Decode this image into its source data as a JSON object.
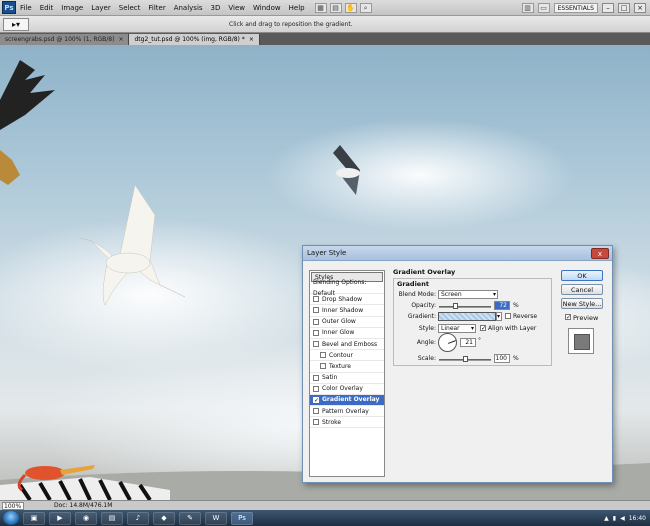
{
  "app": {
    "logo_text": "Ps",
    "menu": [
      "File",
      "Edit",
      "Image",
      "Layer",
      "Select",
      "Filter",
      "Analysis",
      "3D",
      "View",
      "Window",
      "Help"
    ],
    "workspace": "ESSENTIALS"
  },
  "options_bar": {
    "hint": "Click and drag to reposition the gradient."
  },
  "tabs": [
    {
      "label": "screengrabs.psd @ 100% (1, RGB/8)",
      "close": "×"
    },
    {
      "label": "dtg2_tut.psd @ 100% (img, RGB/8) *",
      "close": "×"
    }
  ],
  "status_bar": {
    "zoom": "100%",
    "doc": "Doc: 14.8M/476.1M"
  },
  "taskbar": {
    "clock": "16:40"
  },
  "dialog": {
    "title": "Layer Style",
    "close_label": "x",
    "styles": [
      {
        "label": "Styles",
        "type": "header"
      },
      {
        "label": "Blending Options: Default",
        "type": "plain"
      },
      {
        "label": "Drop Shadow",
        "checked": false
      },
      {
        "label": "Inner Shadow",
        "checked": false
      },
      {
        "label": "Outer Glow",
        "checked": false
      },
      {
        "label": "Inner Glow",
        "checked": false
      },
      {
        "label": "Bevel and Emboss",
        "checked": false
      },
      {
        "label": "Contour",
        "checked": false,
        "indent": true
      },
      {
        "label": "Texture",
        "checked": false,
        "indent": true
      },
      {
        "label": "Satin",
        "checked": false
      },
      {
        "label": "Color Overlay",
        "checked": false
      },
      {
        "label": "Gradient Overlay",
        "checked": true,
        "selected": true
      },
      {
        "label": "Pattern Overlay",
        "checked": false
      },
      {
        "label": "Stroke",
        "checked": false
      }
    ],
    "panel": {
      "title": "Gradient Overlay",
      "group": "Gradient",
      "blend_mode_label": "Blend Mode:",
      "blend_mode": "Screen",
      "opacity_label": "Opacity:",
      "opacity": "72",
      "opacity_fraction": 0.3,
      "percent": "%",
      "gradient_label": "Gradient:",
      "reverse_label": "Reverse",
      "style_label": "Style:",
      "style": "Linear",
      "align_label": "Align with Layer",
      "align_checked": true,
      "angle_label": "Angle:",
      "angle": "21",
      "degree": "°",
      "scale_label": "Scale:",
      "scale": "100",
      "scale_fraction": 0.5
    },
    "buttons": {
      "ok": "OK",
      "cancel": "Cancel",
      "new_style": "New Style...",
      "preview_label": "Preview",
      "preview_checked": true
    }
  },
  "colors": {
    "accent": "#3b6bc3",
    "taskbar": "#1d2e42"
  }
}
